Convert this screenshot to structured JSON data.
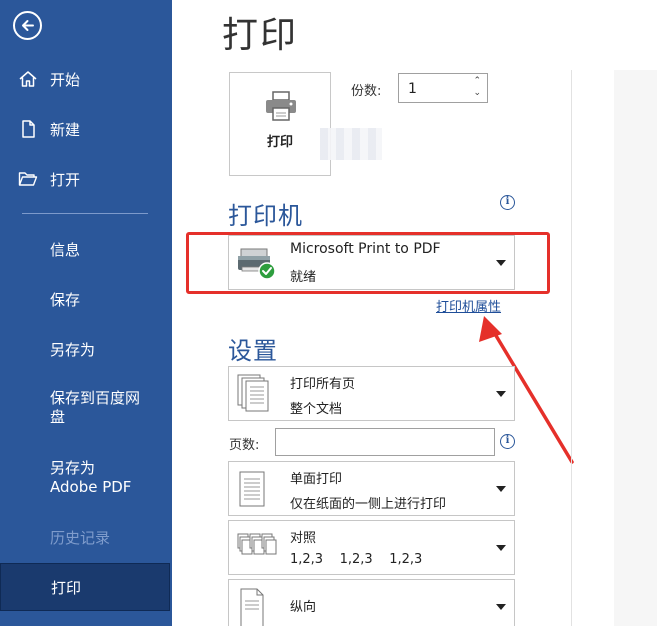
{
  "sidebar": {
    "top_items": [
      {
        "label": "开始",
        "icon": "home-icon"
      },
      {
        "label": "新建",
        "icon": "new-document-icon"
      },
      {
        "label": "打开",
        "icon": "open-folder-icon"
      }
    ],
    "items": [
      {
        "label": "信息"
      },
      {
        "label": "保存"
      },
      {
        "label": "另存为"
      },
      {
        "line1": "保存到百度网",
        "line2": "盘"
      },
      {
        "line1": "另存为",
        "line2": "Adobe PDF"
      },
      {
        "label": "历史记录",
        "disabled": true
      },
      {
        "label": "打印",
        "active": true
      }
    ]
  },
  "main": {
    "title": "打印",
    "print_button_label": "打印",
    "copies_label": "份数:",
    "copies_value": "1",
    "printer_section": "打印机",
    "printer": {
      "name": "Microsoft Print to PDF",
      "status": "就绪"
    },
    "printer_properties_link": "打印机属性",
    "settings_section": "设置",
    "settings": [
      {
        "line1": "打印所有页",
        "line2": "整个文档"
      },
      {
        "line1": "单面打印",
        "line2": "仅在纸面的一侧上进行打印"
      },
      {
        "line1": "对照",
        "line2": "1,2,3    1,2,3    1,2,3"
      },
      {
        "line1": "纵向"
      }
    ],
    "pages_label": "页数:",
    "pages_value": ""
  },
  "colors": {
    "sidebar": "#2b579a",
    "sidebar_active": "#1a3a6e",
    "accent": "#2b579a",
    "highlight": "#e5302a"
  }
}
